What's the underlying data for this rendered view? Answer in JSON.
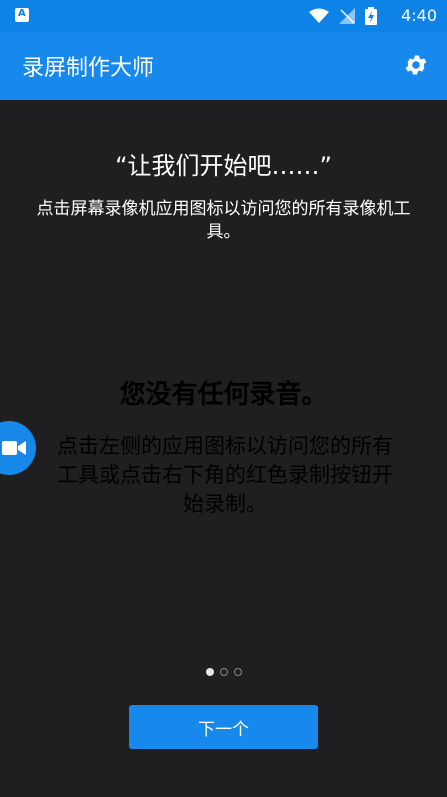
{
  "status_bar": {
    "time": "4:40",
    "icons": [
      "app-a-icon",
      "wifi-icon",
      "signal-icon",
      "battery-charging-icon"
    ]
  },
  "toolbar": {
    "title": "录屏制作大师",
    "settings_icon": "gear-icon"
  },
  "intro": {
    "headline": "“让我们开始吧……”",
    "subtext": "点击屏幕录像机应用图标以访问您的所有录像机工具。"
  },
  "empty_state": {
    "title": "您没有任何录音。",
    "description": "点击左侧的应用图标以访问您的所有工具或点击右下角的红色录制按钮开始录制。"
  },
  "floating_button": {
    "icon": "video-camera-icon"
  },
  "pager": {
    "count": 3,
    "active_index": 0
  },
  "next_button": {
    "label": "下一个"
  },
  "colors": {
    "accent": "#1889ec",
    "background": "#1f1f21"
  }
}
